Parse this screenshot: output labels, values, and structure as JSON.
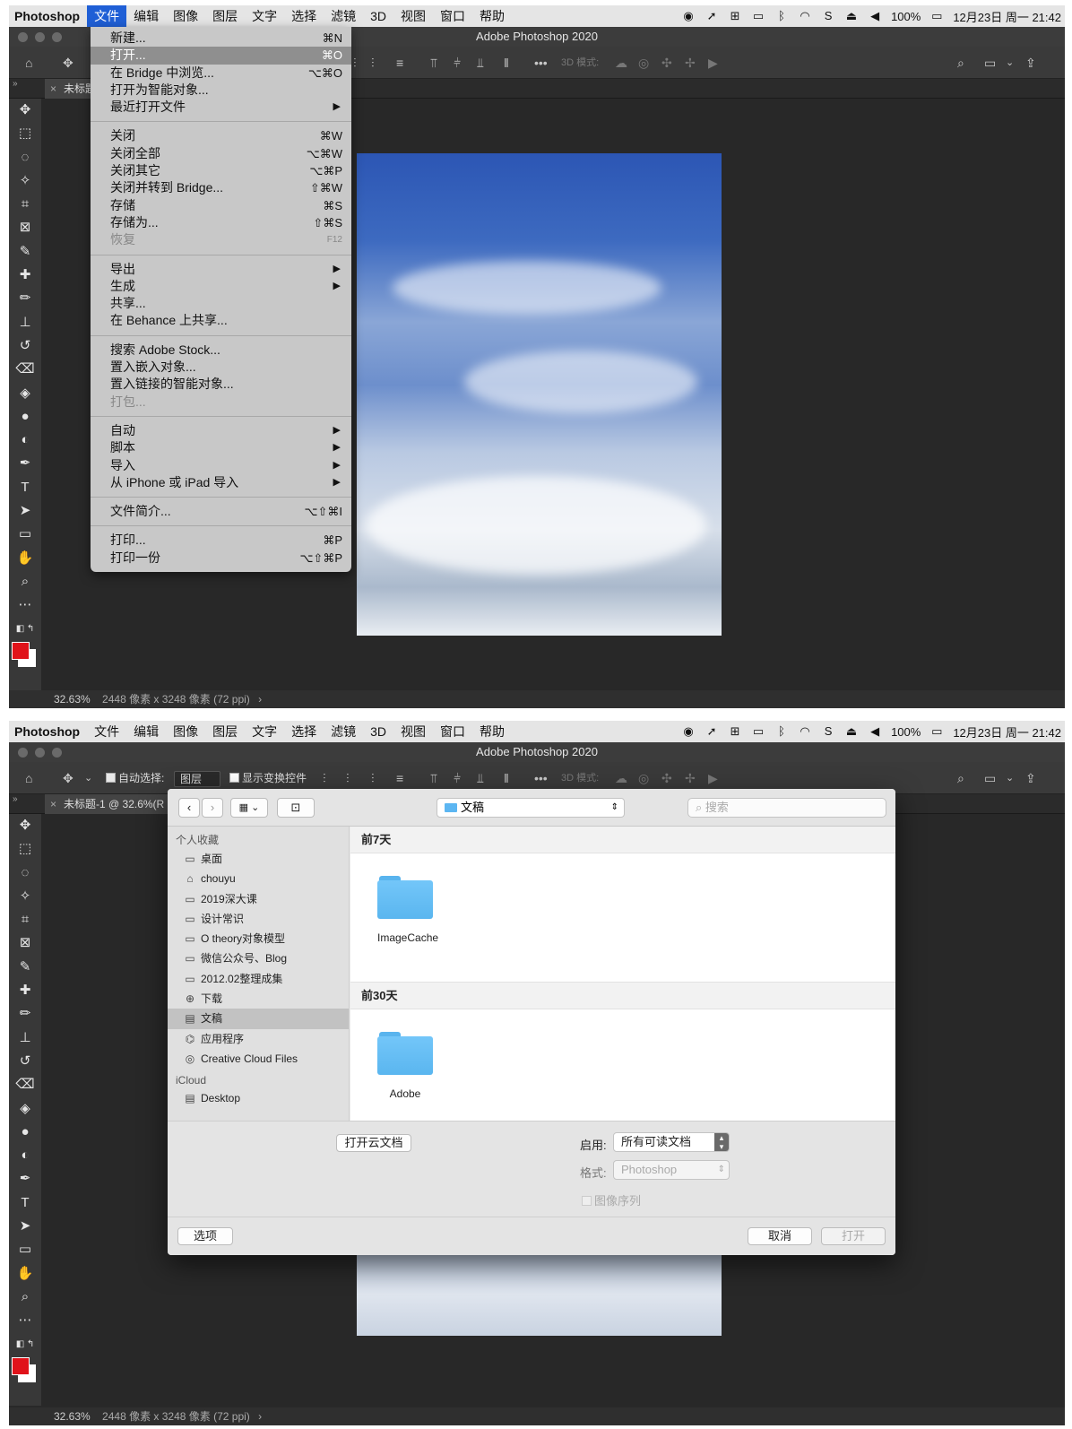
{
  "menubar": {
    "app": "Photoshop",
    "items": [
      "文件",
      "编辑",
      "图像",
      "图层",
      "文字",
      "选择",
      "滤镜",
      "3D",
      "视图",
      "窗口",
      "帮助"
    ],
    "battery": "100%",
    "clock": "12月23日 周一 21:42"
  },
  "window": {
    "title": "Adobe Photoshop 2020"
  },
  "document": {
    "tab_short": "未标题",
    "tab_full": "未标题-1 @ 32.6%(R",
    "zoom": "32.63%",
    "info": "2448 像素 x 3248 像素 (72 ppi)"
  },
  "options_bar": {
    "auto_select_label": "自动选择:",
    "auto_select_target": "图层",
    "show_transform_label": "显示变换控件",
    "mode_3d": "3D 模式:"
  },
  "file_menu": {
    "groups": [
      [
        {
          "label": "新建...",
          "shortcut": "⌘N"
        },
        {
          "label": "打开...",
          "shortcut": "⌘O",
          "highlighted": true
        },
        {
          "label": "在 Bridge 中浏览...",
          "shortcut": "⌥⌘O"
        },
        {
          "label": "打开为智能对象..."
        },
        {
          "label": "最近打开文件",
          "submenu": true
        }
      ],
      [
        {
          "label": "关闭",
          "shortcut": "⌘W"
        },
        {
          "label": "关闭全部",
          "shortcut": "⌥⌘W"
        },
        {
          "label": "关闭其它",
          "shortcut": "⌥⌘P"
        },
        {
          "label": "关闭并转到 Bridge...",
          "shortcut": "⇧⌘W"
        },
        {
          "label": "存储",
          "shortcut": "⌘S"
        },
        {
          "label": "存储为...",
          "shortcut": "⇧⌘S"
        },
        {
          "label": "恢复",
          "shortcut": "F12",
          "disabled": true
        }
      ],
      [
        {
          "label": "导出",
          "submenu": true
        },
        {
          "label": "生成",
          "submenu": true
        },
        {
          "label": "共享..."
        },
        {
          "label": "在 Behance 上共享..."
        }
      ],
      [
        {
          "label": "搜索 Adobe Stock..."
        },
        {
          "label": "置入嵌入对象..."
        },
        {
          "label": "置入链接的智能对象..."
        },
        {
          "label": "打包...",
          "disabled": true
        }
      ],
      [
        {
          "label": "自动",
          "submenu": true
        },
        {
          "label": "脚本",
          "submenu": true
        },
        {
          "label": "导入",
          "submenu": true
        },
        {
          "label": "从 iPhone 或 iPad 导入",
          "submenu": true
        }
      ],
      [
        {
          "label": "文件简介...",
          "shortcut": "⌥⇧⌘I"
        }
      ],
      [
        {
          "label": "打印...",
          "shortcut": "⌘P"
        },
        {
          "label": "打印一份",
          "shortcut": "⌥⇧⌘P"
        }
      ]
    ]
  },
  "open_dialog": {
    "location": "文稿",
    "search_placeholder": "搜索",
    "sidebar": {
      "favorites_header": "个人收藏",
      "favorites": [
        {
          "label": "桌面",
          "icon": "desktop-icon"
        },
        {
          "label": "chouyu",
          "icon": "home-icon"
        },
        {
          "label": "2019深大课",
          "icon": "folder-icon"
        },
        {
          "label": "设计常识",
          "icon": "folder-icon"
        },
        {
          "label": "O theory对象模型",
          "icon": "folder-icon"
        },
        {
          "label": "微信公众号、Blog",
          "icon": "folder-icon"
        },
        {
          "label": "2012.02整理成集",
          "icon": "folder-icon"
        },
        {
          "label": "下载",
          "icon": "download-icon"
        },
        {
          "label": "文稿",
          "icon": "document-icon",
          "selected": true
        },
        {
          "label": "应用程序",
          "icon": "apps-icon"
        },
        {
          "label": "Creative Cloud Files",
          "icon": "creative-cloud-icon"
        }
      ],
      "icloud_header": "iCloud",
      "icloud": [
        {
          "label": "Desktop",
          "icon": "document-icon"
        }
      ]
    },
    "sections": [
      {
        "title": "前7天",
        "items": [
          "ImageCache"
        ]
      },
      {
        "title": "前30天",
        "items": [
          "Adobe"
        ]
      }
    ],
    "open_cloud_button": "打开云文档",
    "enable_label": "启用:",
    "enable_value": "所有可读文档",
    "format_label": "格式:",
    "format_value": "Photoshop",
    "image_sequence_label": "图像序列",
    "options_button": "选项",
    "cancel_button": "取消",
    "open_button": "打开"
  }
}
